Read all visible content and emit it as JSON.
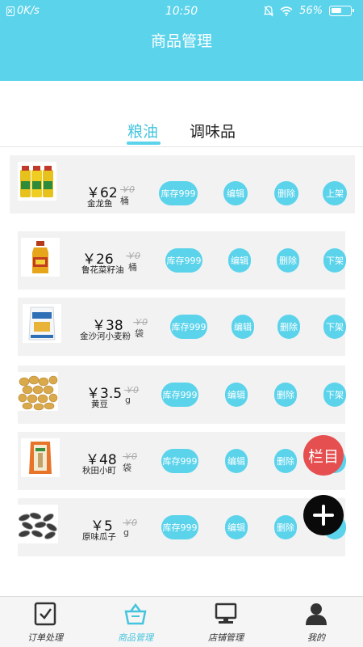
{
  "status": {
    "net_speed": "0K/s",
    "time": "10:50",
    "battery_pct": "56%",
    "battery_level": 0.56
  },
  "header": {
    "title": "商品管理"
  },
  "tabs": [
    {
      "label": "粮油",
      "active": true
    },
    {
      "label": "调味品",
      "active": false
    }
  ],
  "products": [
    {
      "price": "￥62",
      "old_price": "￥0",
      "unit": "桶",
      "name": "金龙鱼",
      "stock_label": "库存999",
      "edit_label": "编辑",
      "delete_label": "删除",
      "toggle_label": "上架",
      "image": "oil-bottles-icon"
    },
    {
      "price": "￥26",
      "old_price": "￥0",
      "unit": "桶",
      "name": "鲁花菜籽油",
      "stock_label": "库存999",
      "edit_label": "编辑",
      "delete_label": "删除",
      "toggle_label": "下架",
      "image": "oil-bottle-icon"
    },
    {
      "price": "￥38",
      "old_price": "￥0",
      "unit": "袋",
      "name": "金沙河小麦粉",
      "stock_label": "库存999",
      "edit_label": "编辑",
      "delete_label": "删除",
      "toggle_label": "下架",
      "image": "flour-bag-icon"
    },
    {
      "price": "￥3.5",
      "old_price": "￥0",
      "unit": "g",
      "name": "黄豆",
      "stock_label": "库存999",
      "edit_label": "编辑",
      "delete_label": "删除",
      "toggle_label": "下架",
      "image": "soybeans-icon"
    },
    {
      "price": "￥48",
      "old_price": "￥0",
      "unit": "袋",
      "name": "秋田小町",
      "stock_label": "库存999",
      "edit_label": "编辑",
      "delete_label": "删除",
      "toggle_label": "",
      "image": "rice-bag-icon"
    },
    {
      "price": "￥5",
      "old_price": "￥0",
      "unit": "g",
      "name": "原味瓜子",
      "stock_label": "库存999",
      "edit_label": "编辑",
      "delete_label": "删除",
      "toggle_label": "",
      "image": "sunflower-seeds-icon"
    }
  ],
  "fab": {
    "menu_label": "栏目"
  },
  "nav": [
    {
      "label": "订单处理",
      "icon": "order-checklist-icon",
      "active": false
    },
    {
      "label": "商品管理",
      "icon": "basket-icon",
      "active": true
    },
    {
      "label": "店铺管理",
      "icon": "computer-icon",
      "active": false
    },
    {
      "label": "我的",
      "icon": "person-icon",
      "active": false
    }
  ],
  "colors": {
    "accent": "#5bd3eb",
    "fab_red": "#e64f4f",
    "fab_black": "#0a0a0a"
  }
}
